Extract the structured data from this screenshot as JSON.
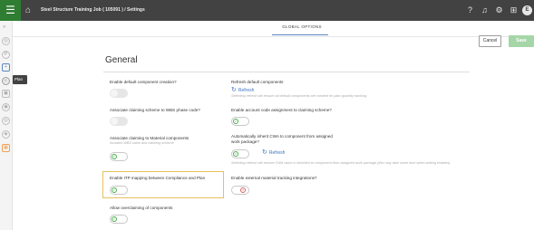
{
  "topbar": {
    "menu_icon": "hamburger-icon",
    "home_icon": "home-icon",
    "breadcrumb": "Steel Structure Training Job ( 105091 )  /  Settings",
    "right_icons": [
      "help-icon",
      "bell-icon",
      "settings-icon",
      "grid-icon"
    ],
    "avatar_initial": "E"
  },
  "sidebar": {
    "collapse_icon": "chevron-right-icon",
    "items": [
      "item",
      "item",
      "item",
      "item",
      "item",
      "item",
      "item",
      "item",
      "item",
      "item",
      "item"
    ],
    "tooltip": "Plan"
  },
  "tabs": {
    "active": "GLOBAL OPTIONS"
  },
  "actions": {
    "cancel": "Cancel",
    "save": "Save"
  },
  "section": {
    "title": "General"
  },
  "options": {
    "enable_default_component_creation": "Enable default component creation?",
    "refresh_default_components": "Refresh default components",
    "refresh": "Refresh",
    "refresh_default_sub": "Selecting refresh will ensure all default components are created for plan quantity tracking.",
    "associate_claiming_wbs": "Associate claiming scheme to WBS phase code?",
    "enable_account_code": "Enable account code assignment to claiming scheme?",
    "associate_claiming_material": "Associate claiming to Material components",
    "associate_claiming_material_sub": "Includes WBS value and claiming scheme",
    "auto_inherit_cwa": "Automatically inherit CWA to component from assigned",
    "auto_inherit_cwa_2": "work package?",
    "auto_inherit_sub": "Selecting refresh will ensure CWA value is inherited to component from assigned work package (this may take some time when setting enables)",
    "enable_itp_mapping": "Enable ITP mapping between Compliance and Plan",
    "enable_external_material": "Enable external material tracking integrations?",
    "allow_overclaiming": "Allow overclaiming of components"
  },
  "colors": {
    "accent_green": "#2e7d32",
    "link_blue": "#3d73c1",
    "highlight": "#e8c060"
  }
}
